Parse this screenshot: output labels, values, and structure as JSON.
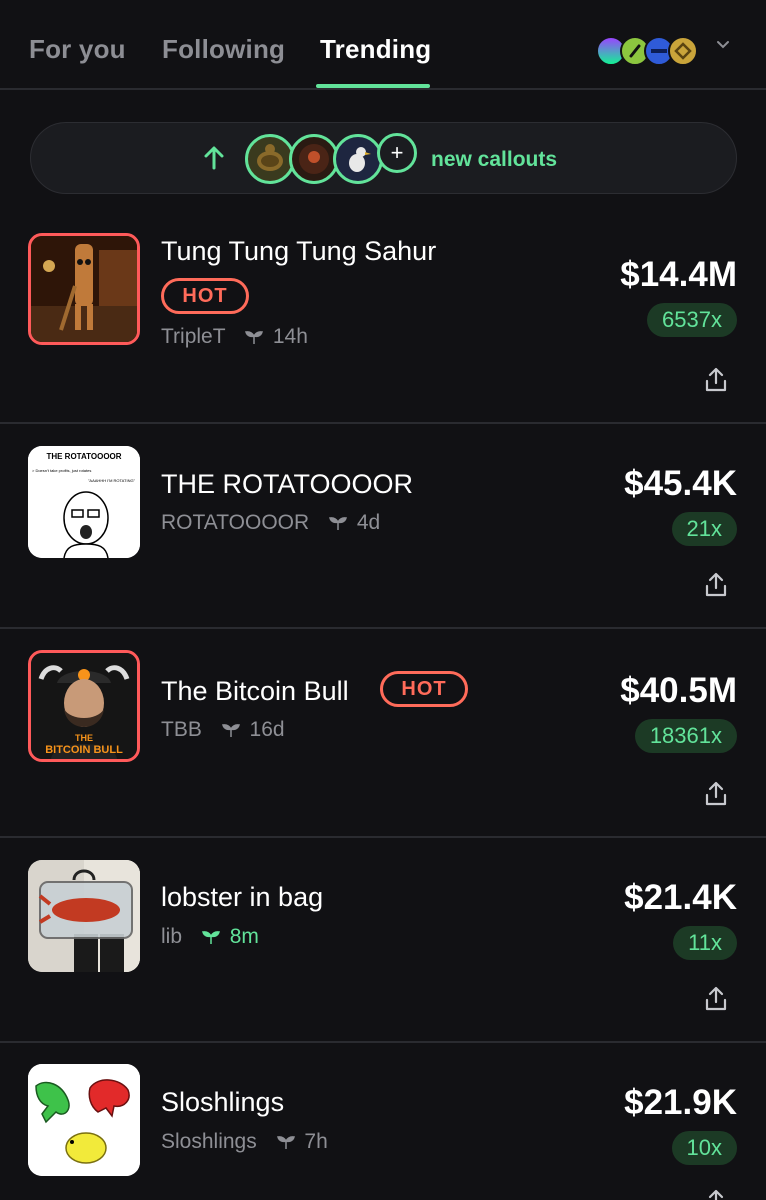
{
  "tabs": [
    {
      "label": "For you",
      "active": false
    },
    {
      "label": "Following",
      "active": false
    },
    {
      "label": "Trending",
      "active": true
    }
  ],
  "chain_selector": {
    "icons": [
      "solana-icon",
      "green-chain-icon",
      "blue-chain-icon",
      "bnb-icon"
    ],
    "colors": [
      "#7b5cff",
      "#8cc63f",
      "#2f5bd8",
      "#c9a43a"
    ],
    "accent": "#62e39a"
  },
  "callouts": {
    "label": "new callouts",
    "plus": "+",
    "avatars": [
      "turtle-avatar",
      "dark-creature-avatar",
      "seagull-avatar"
    ]
  },
  "tokens": [
    {
      "name": "Tung Tung Tung Sahur",
      "ticker": "TripleT",
      "age": "14h",
      "hot": true,
      "hot_label": "HOT",
      "market_cap": "$14.4M",
      "multiplier": "6537x",
      "fresh": false
    },
    {
      "name": "THE ROTATOOOOR",
      "ticker": "ROTATOOOOR",
      "age": "4d",
      "hot": false,
      "market_cap": "$45.4K",
      "multiplier": "21x",
      "fresh": false,
      "image_text": {
        "title": "THE ROTATOOOOR",
        "left": "> Doesn't take profits, just rotates",
        "right": "\"AAAHHH I'M ROTATING\""
      }
    },
    {
      "name": "The Bitcoin Bull",
      "ticker": "TBB",
      "age": "16d",
      "hot": true,
      "hot_label": "HOT",
      "market_cap": "$40.5M",
      "multiplier": "18361x",
      "fresh": false,
      "image_text": {
        "caption_1": "THE",
        "caption_2": "BITCOIN BULL"
      }
    },
    {
      "name": "lobster in bag",
      "ticker": "lib",
      "age": "8m",
      "hot": false,
      "market_cap": "$21.4K",
      "multiplier": "11x",
      "fresh": true
    },
    {
      "name": "Sloshlings",
      "ticker": "Sloshlings",
      "age": "7h",
      "hot": false,
      "market_cap": "$21.9K",
      "multiplier": "10x",
      "fresh": false
    }
  ],
  "colors": {
    "background": "#111114",
    "positive": "#62e39a",
    "hot": "#ff6b5a",
    "divider": "#2a2b30"
  }
}
